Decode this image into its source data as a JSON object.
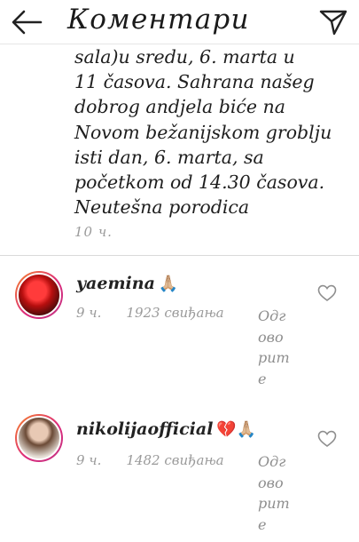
{
  "header": {
    "title": "Коментари",
    "back_icon": "back-arrow-icon",
    "send_icon": "paper-plane-icon"
  },
  "caption": {
    "lines": [
      "sala)u sredu, 6. marta u",
      "11 časova. Sahrana našeg",
      "dobrog andjela biće na",
      "Novom bežanijskom groblju",
      "isti dan, 6. marta, sa",
      "početkom od 14.30 časova.",
      "Neutešna porodica"
    ],
    "time": "10 ч."
  },
  "comments": [
    {
      "username": "yaemina",
      "emoji": "🙏🏼",
      "time": "9 ч.",
      "likes": "1923 свиђања",
      "reply": "Одговорите"
    },
    {
      "username": "nikolijaofficial",
      "emoji": "💔🙏🏼",
      "time": "9 ч.",
      "likes": "1482 свиђања",
      "reply": "Одговорите"
    }
  ],
  "colors": {
    "text": "#262626",
    "muted": "#9a9a9a",
    "divider": "#dadada",
    "story_ring_start": "#f58529",
    "story_ring_end": "#c13584"
  }
}
